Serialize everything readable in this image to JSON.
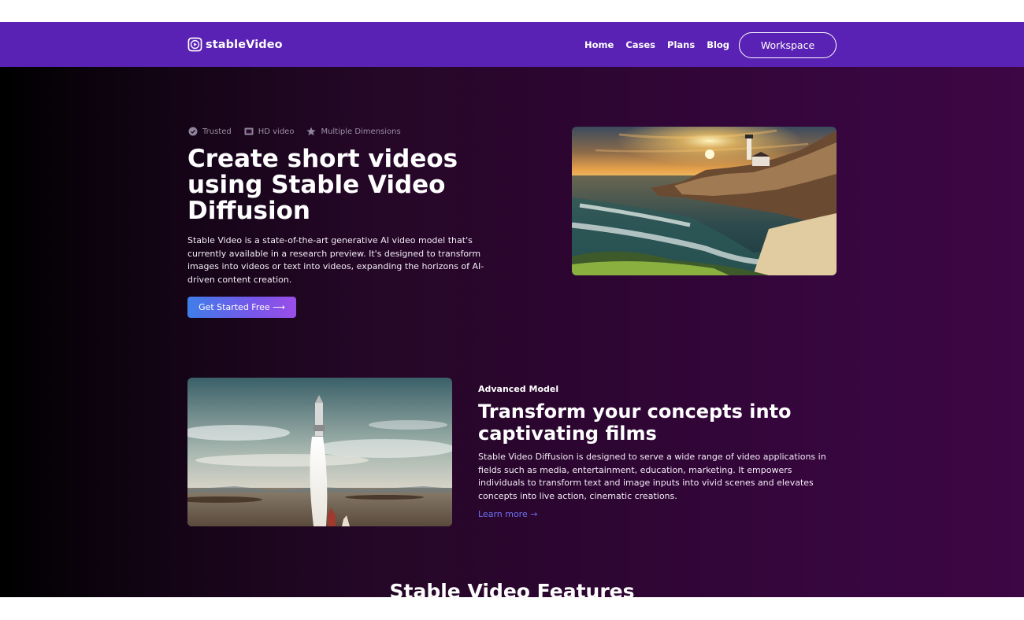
{
  "nav": {
    "logo_text": "stableVideo",
    "links": [
      "Home",
      "Cases",
      "Plans",
      "Blog"
    ],
    "workspace_label": "Workspace"
  },
  "hero": {
    "badges": [
      {
        "icon": "check-shield-icon",
        "label": "Trusted"
      },
      {
        "icon": "film-icon",
        "label": "HD video"
      },
      {
        "icon": "star-icon",
        "label": "Multiple Dimensions"
      }
    ],
    "title": "Create short videos using Stable Video Diffusion",
    "description": "Stable Video is a state-of-the-art generative AI video model that's currently available in a research preview. It's designed to transform images into videos or text into videos, expanding the horizons of AI-driven content creation.",
    "cta_label": "Get Started Free ⟶"
  },
  "section2": {
    "eyebrow": "Advanced Model",
    "title": "Transform your concepts into captivating films",
    "description": "Stable Video Diffusion is designed to serve a wide range of video applications in fields such as media, entertainment, education, marketing. It empowers individuals to transform text and image inputs into vivid scenes and elevates concepts into live action, cinematic creations.",
    "learn_more": "Learn more →"
  },
  "features": {
    "title": "Stable Video Features"
  },
  "colors": {
    "nav_bg": "#5a22b4",
    "cta_start": "#3f7ee9",
    "cta_end": "#9a4ee8",
    "link": "#6e72f2"
  }
}
